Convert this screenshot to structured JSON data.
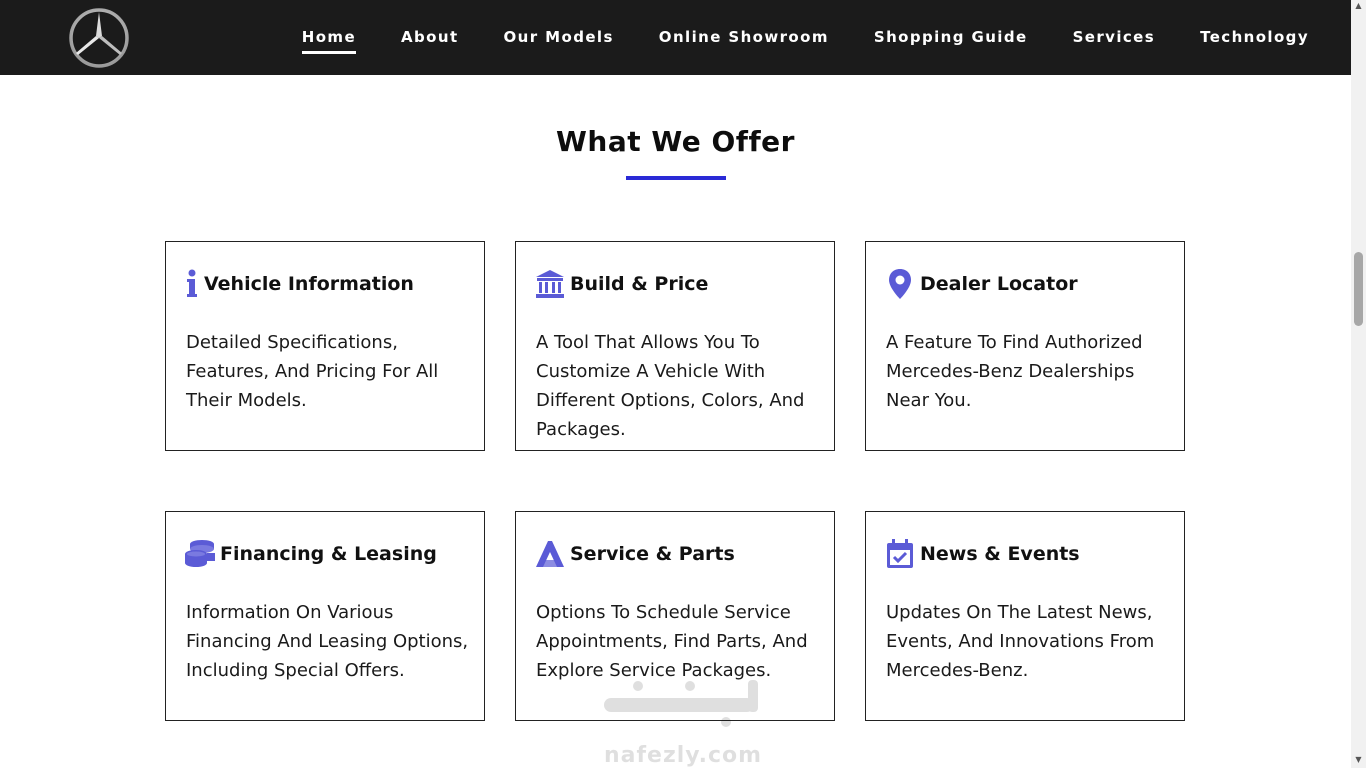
{
  "navbar": {
    "logo": "mercedes-star-logo",
    "links": [
      {
        "label": "Home",
        "active": true
      },
      {
        "label": "About",
        "active": false
      },
      {
        "label": "Our Models",
        "active": false
      },
      {
        "label": "Online Showroom",
        "active": false
      },
      {
        "label": "Shopping Guide",
        "active": false
      },
      {
        "label": "Services",
        "active": false
      },
      {
        "label": "Technology",
        "active": false
      }
    ]
  },
  "section": {
    "title": "What We Offer"
  },
  "cards": [
    {
      "icon": "info-icon",
      "title": "Vehicle Information",
      "description": "Detailed Specifications, Features, And Pricing For All Their Models."
    },
    {
      "icon": "bank-icon",
      "title": "Build & Price",
      "description": "A Tool That Allows You To Customize A Vehicle With Different Options, Colors, And Packages."
    },
    {
      "icon": "map-pin-icon",
      "title": "Dealer Locator",
      "description": "A Feature To Find Authorized Mercedes-Benz Dealerships Near You."
    },
    {
      "icon": "coins-icon",
      "title": "Financing & Leasing",
      "description": "Information On Various Financing And Leasing Options, Including Special Offers."
    },
    {
      "icon": "wrench-a-icon",
      "title": "Service & Parts",
      "description": "Options To Schedule Service Appointments, Find Parts, And Explore Service Packages."
    },
    {
      "icon": "calendar-check-icon",
      "title": "News & Events",
      "description": "Updates On The Latest News, Events, And Innovations From Mercedes-Benz."
    }
  ],
  "watermark": {
    "text": "nafezly.com"
  },
  "colors": {
    "navbar_bg": "#1b1b1b",
    "accent": "#2a2ad6",
    "icon": "#5b5bd6"
  }
}
